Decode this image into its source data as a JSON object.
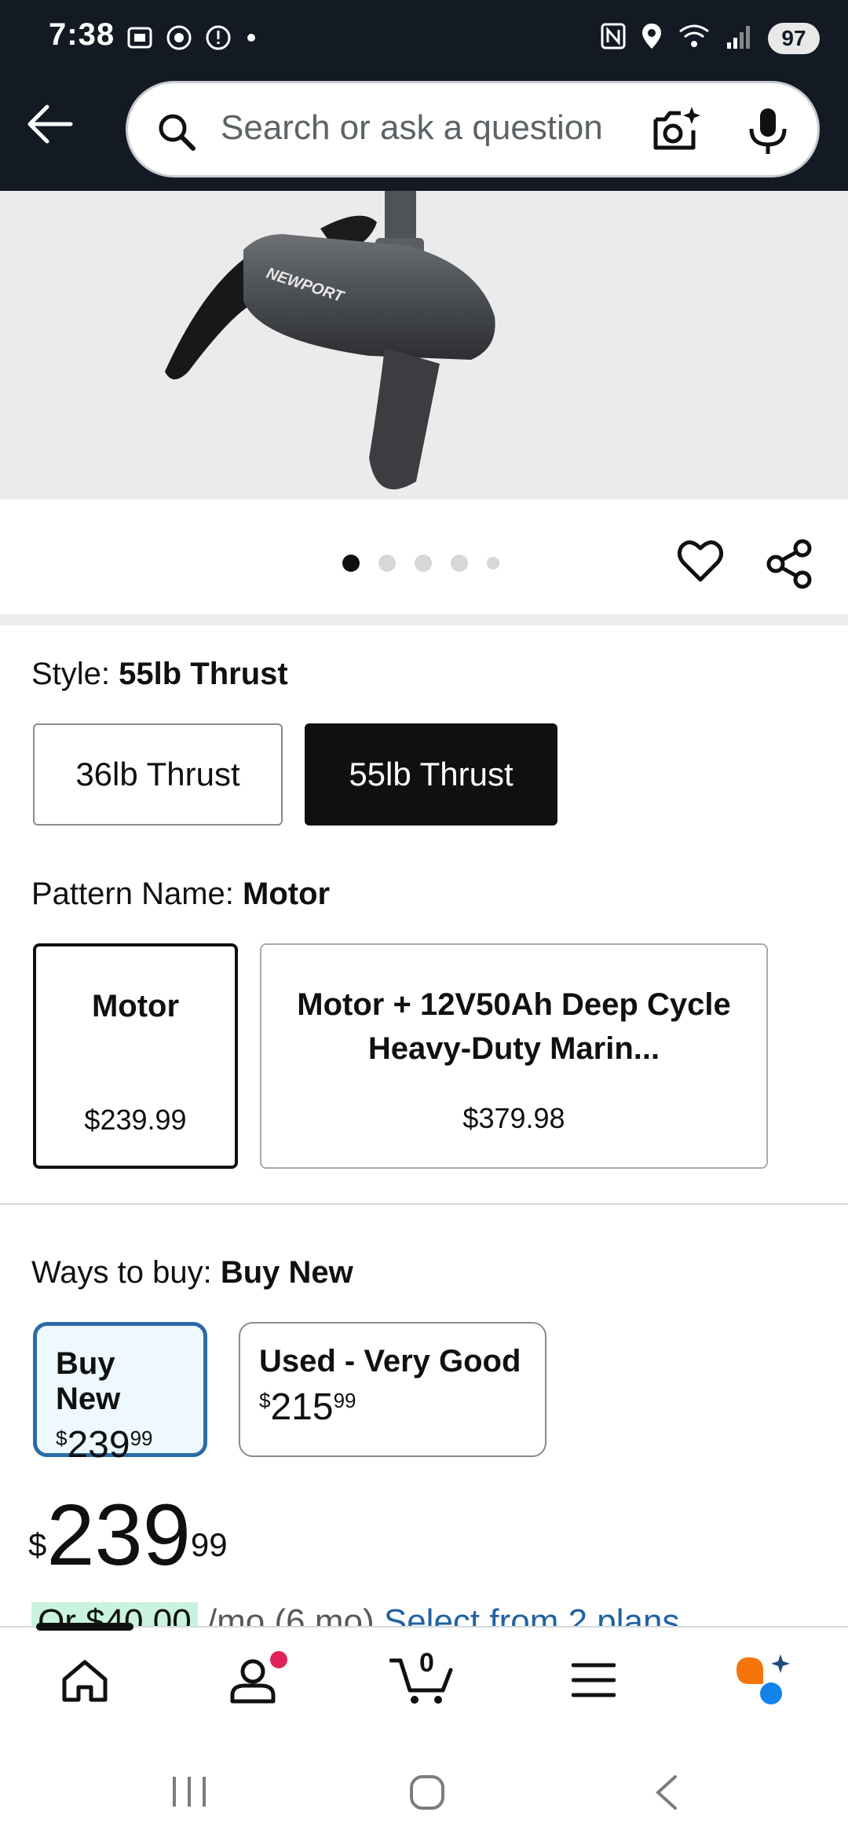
{
  "status_bar": {
    "time": "7:38",
    "battery": "97"
  },
  "header": {
    "search_placeholder": "Search or ask a question"
  },
  "hero": {
    "brand_text": "NEWPORT",
    "image_count": 5,
    "active_image": 1
  },
  "style": {
    "label": "Style: ",
    "selected": "55lb Thrust",
    "options": [
      "36lb Thrust",
      "55lb Thrust"
    ]
  },
  "pattern": {
    "label": "Pattern Name: ",
    "selected": "Motor",
    "options": [
      {
        "title": "Motor",
        "price": "$239.99"
      },
      {
        "title": "Motor + 12V50Ah Deep Cycle Heavy-Duty Marin...",
        "price": "$379.98"
      }
    ]
  },
  "ways_to_buy": {
    "label": "Ways to buy: ",
    "selected": "Buy New",
    "options": [
      {
        "title": "Buy New",
        "currency": "$",
        "whole": "239",
        "cents": "99"
      },
      {
        "title": "Used - Very Good",
        "currency": "$",
        "whole": "215",
        "cents": "99"
      }
    ]
  },
  "price": {
    "currency": "$",
    "whole": "239",
    "cents": "99"
  },
  "plans": {
    "monthly": "Or $40.00",
    "term": " /mo (6 mo) ",
    "link": "Select from 2 plans"
  },
  "bottom_nav": {
    "cart_count": "0",
    "items": [
      "home",
      "account",
      "cart",
      "menu",
      "rufus"
    ]
  },
  "colors": {
    "header_bg": "#131a24",
    "selected_blue": "#2c6ca5",
    "link_blue": "#2162a1",
    "highlight_green": "#c9f3df",
    "badge_pink": "#e0225a"
  }
}
